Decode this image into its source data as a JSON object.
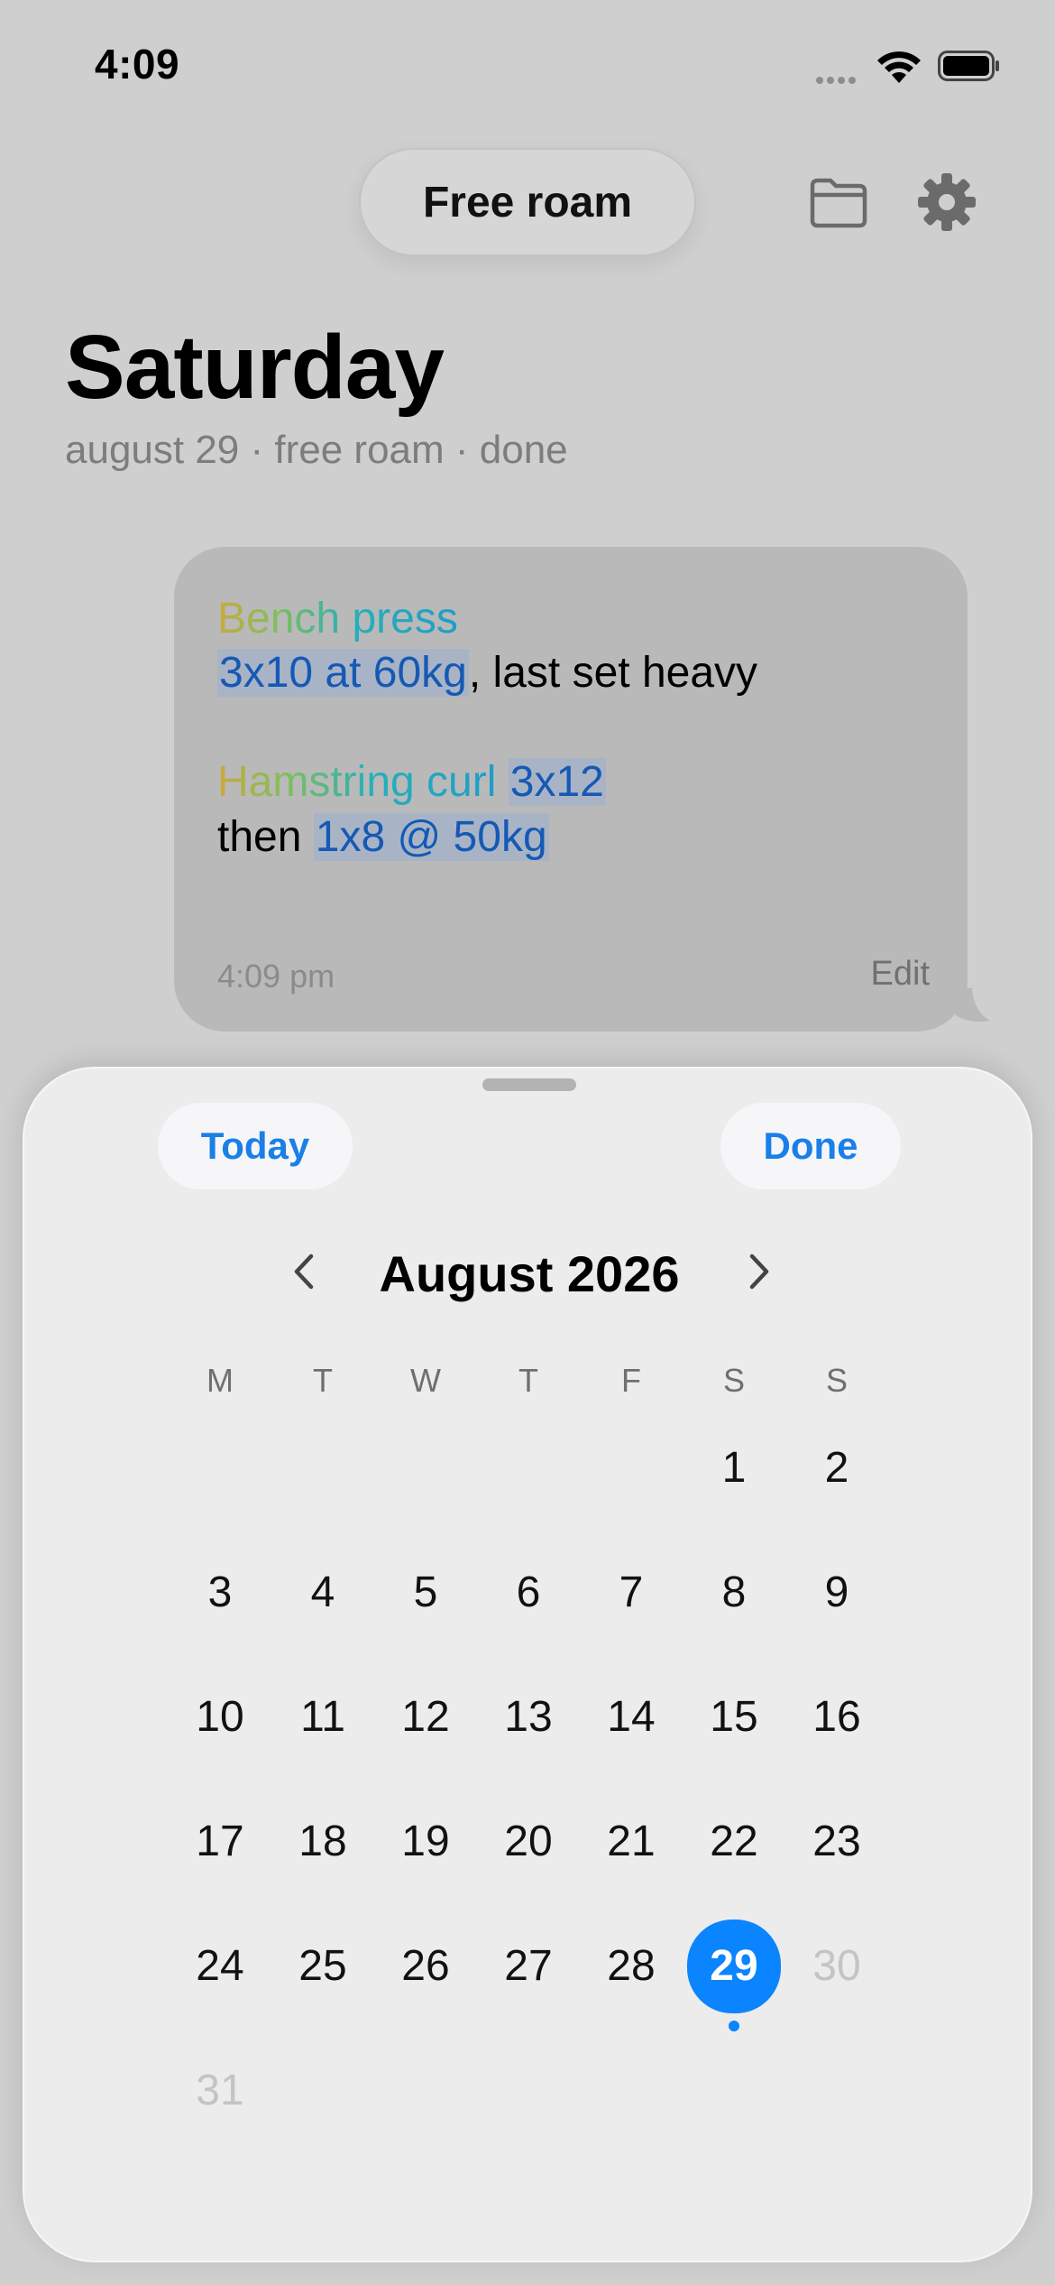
{
  "status": {
    "time": "4:09"
  },
  "header": {
    "mode_label": "Free roam",
    "folder_icon": "folder-icon",
    "settings_icon": "gear-icon"
  },
  "day": {
    "title": "Saturday",
    "subtitle": "august 29 · free roam · done"
  },
  "note": {
    "ex1_name": "Bench press",
    "ex1_detail": "3x10 at 60kg",
    "ex1_rest": ", last set heavy",
    "ex2_name": "Hamstring curl",
    "ex2_sets": "3x12",
    "ex2_then": "then",
    "ex2_detail": "1x8 @ 50kg",
    "time": "4:09 pm",
    "edit_label": "Edit"
  },
  "calendar": {
    "today_label": "Today",
    "done_label": "Done",
    "month_title": "August 2026",
    "weekdays": [
      "M",
      "T",
      "W",
      "T",
      "F",
      "S",
      "S"
    ],
    "selected_day": "29",
    "accent": "#0A84FF",
    "days": [
      "1",
      "2",
      "3",
      "4",
      "5",
      "6",
      "7",
      "8",
      "9",
      "10",
      "11",
      "12",
      "13",
      "14",
      "15",
      "16",
      "17",
      "18",
      "19",
      "20",
      "21",
      "22",
      "23",
      "24",
      "25",
      "26",
      "27",
      "28",
      "29",
      "30",
      "31"
    ]
  }
}
